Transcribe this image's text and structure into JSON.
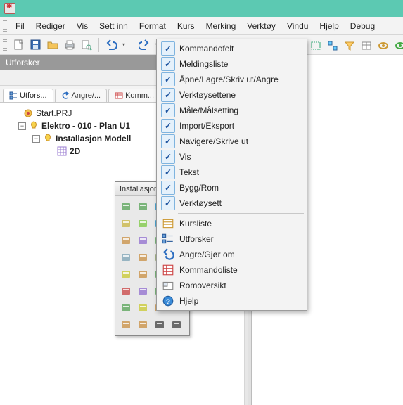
{
  "menu": {
    "items": [
      "Fil",
      "Rediger",
      "Vis",
      "Sett inn",
      "Format",
      "Kurs",
      "Merking",
      "Verktøy",
      "Vindu",
      "Hjelp",
      "Debug"
    ]
  },
  "panel": {
    "title": "Utforsker"
  },
  "tabs": {
    "items": [
      {
        "label": "Utfors...",
        "active": true
      },
      {
        "label": "Angre/...",
        "active": false
      },
      {
        "label": "Komm...",
        "active": false
      }
    ]
  },
  "tree": {
    "n0": "Start.PRJ",
    "n1": "Elektro - 010 - Plan U1",
    "n2": "Installasjon Modell",
    "n3": "2D"
  },
  "toolbox": {
    "title": "Installasjon"
  },
  "dropdown": {
    "checked": [
      "Kommandofelt",
      "Meldingsliste",
      "Åpne/Lagre/Skriv ut/Angre",
      "Verktøysettene",
      "Måle/Målsetting",
      "Import/Eksport",
      "Navigere/Skrive ut",
      "Vis",
      "Tekst",
      "Bygg/Rom",
      "Verktøysett"
    ],
    "rest": [
      {
        "label": "Kursliste",
        "icon": "list"
      },
      {
        "label": "Utforsker",
        "icon": "tree"
      },
      {
        "label": "Angre/Gjør om",
        "icon": "undo"
      },
      {
        "label": "Kommandoliste",
        "icon": "grid"
      },
      {
        "label": "Romoversikt",
        "icon": "room"
      },
      {
        "label": "Hjelp",
        "icon": "help"
      }
    ]
  }
}
